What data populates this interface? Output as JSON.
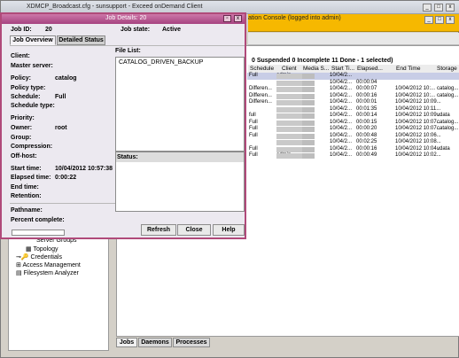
{
  "app": {
    "title": "XDMCP_Broadcast.cfg - sunsupport - Exceed onDemand Client",
    "console_title": "ation Console (logged into admin)"
  },
  "jobs_view": {
    "summary": "0 Suspended 0 Incomplete 11 Done - 1 selected)",
    "columns": [
      "Schedule",
      "Client",
      "Media S...",
      "Start Ti...",
      "Elapsed...",
      "End Time",
      "Storage"
    ],
    "rows": [
      [
        "Full",
        "admin",
        "",
        "10/04/2...",
        "",
        "",
        ""
      ],
      [
        "",
        "",
        "",
        "10/04/2...",
        "00:00:04",
        "",
        ""
      ],
      [
        "Differen...",
        "",
        "",
        "10/04/2...",
        "00:00:07",
        "10/04/2012 10:...",
        "catalog..."
      ],
      [
        "Differen...",
        "",
        "",
        "10/04/2...",
        "00:00:16",
        "10/04/2012 10:...",
        "catalog..."
      ],
      [
        "Differen...",
        "",
        "",
        "10/04/2...",
        "00:00:01",
        "10/04/2012 10:09...",
        ""
      ],
      [
        "",
        "",
        "",
        "10/04/2...",
        "00:01:35",
        "10/04/2012 10:11...",
        ""
      ],
      [
        "full",
        "",
        "",
        "10/04/2...",
        "00:00:14",
        "10/04/2012 10:09...",
        "vdata"
      ],
      [
        "Full",
        "",
        "",
        "10/04/2...",
        "00:00:15",
        "10/04/2012 10:07...",
        "catalog..."
      ],
      [
        "Full",
        "",
        "",
        "10/04/2...",
        "00:00:20",
        "10/04/2012 10:07...",
        "catalog..."
      ],
      [
        "Full",
        "",
        "",
        "10/04/2...",
        "00:00:48",
        "10/04/2012 10:06...",
        ""
      ],
      [
        "",
        "",
        "",
        "10/04/2...",
        "00:02:25",
        "10/04/2012 10:08...",
        ""
      ],
      [
        "Full",
        "",
        "",
        "10/04/2...",
        "00:00:16",
        "10/04/2012 10:04...",
        "vdata"
      ],
      [
        "Full",
        "admin",
        "",
        "10/04/2...",
        "00:00:49",
        "10/04/2012 10:02...",
        ""
      ]
    ],
    "bottom_tabs": [
      "Jobs",
      "Daemons",
      "Processes"
    ]
  },
  "tree": {
    "items": [
      "Server Groups",
      "Topology",
      "Credentials",
      "Access Management",
      "Filesystem Analyzer"
    ]
  },
  "job_dialog": {
    "title": "Job Details: 20",
    "job_id_label": "Job ID:",
    "job_id": "20",
    "job_state_label": "Job state:",
    "job_state": "Active",
    "tabs": [
      "Job Overview",
      "Detailed Status"
    ],
    "fields": {
      "client_label": "Client:",
      "master_label": "Master server:",
      "policy_label": "Policy:",
      "policy": "catalog",
      "policy_type_label": "Policy type:",
      "schedule_label": "Schedule:",
      "schedule": "Full",
      "schedule_type_label": "Schedule type:",
      "priority_label": "Priority:",
      "owner_label": "Owner:",
      "owner": "root",
      "group_label": "Group:",
      "compression_label": "Compression:",
      "offhost_label": "Off-host:",
      "start_label": "Start time:",
      "start": "10/04/2012 10:57:38",
      "elapsed_label": "Elapsed time:",
      "elapsed": "0:00:22",
      "end_label": "End time:",
      "retention_label": "Retention:",
      "pathname_label": "Pathname:",
      "percent_label": "Percent complete:"
    },
    "file_list_label": "File List:",
    "file_list": [
      "CATALOG_DRIVEN_BACKUP"
    ],
    "status_label": "Status:",
    "buttons": {
      "refresh": "Refresh",
      "close": "Close",
      "help": "Help"
    }
  }
}
